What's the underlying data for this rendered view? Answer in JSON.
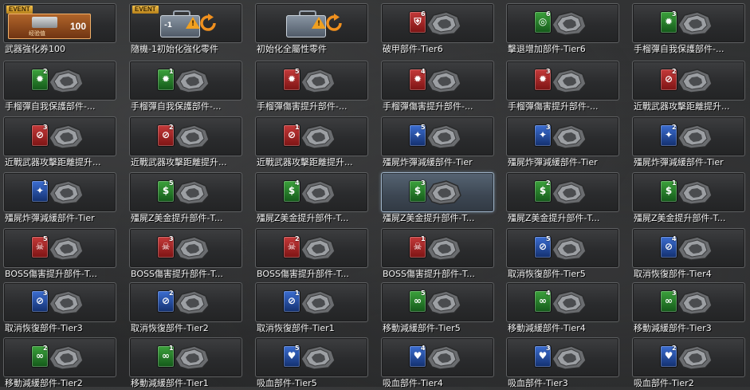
{
  "badge_text": "EVENT",
  "coupon": {
    "count": "100",
    "caption": "经验值"
  },
  "toolbox_text": "-1",
  "selected_index": 21,
  "chip_colors": {
    "red": "#c53a3a",
    "green": "#3ca23c",
    "blue": "#3c6ed2"
  },
  "items": [
    {
      "label": "武器強化券100",
      "kind": "coupon",
      "event": true
    },
    {
      "label": "隨機-1初始化強化零件",
      "kind": "toolbox",
      "event": true,
      "toolbox_text": "-1"
    },
    {
      "label": "初始化全屬性零件",
      "kind": "toolbox",
      "event": false
    },
    {
      "label": "破甲部件-Tier6",
      "kind": "part",
      "color": "red",
      "icon": "shield-icon",
      "tier": "6"
    },
    {
      "label": "擊退增加部件-Tier6",
      "kind": "part",
      "color": "green",
      "icon": "knockback-icon",
      "tier": "6"
    },
    {
      "label": "手榴彈自我保護部件-...",
      "kind": "part",
      "color": "green",
      "icon": "grenade-icon",
      "tier": "3"
    },
    {
      "label": "手榴彈自我保護部件-...",
      "kind": "part",
      "color": "green",
      "icon": "grenade-icon",
      "tier": "2"
    },
    {
      "label": "手榴彈自我保護部件-...",
      "kind": "part",
      "color": "green",
      "icon": "grenade-icon",
      "tier": "1"
    },
    {
      "label": "手榴彈傷害提升部件-...",
      "kind": "part",
      "color": "red",
      "icon": "grenade-icon",
      "tier": "5"
    },
    {
      "label": "手榴彈傷害提升部件-...",
      "kind": "part",
      "color": "red",
      "icon": "grenade-icon",
      "tier": "4"
    },
    {
      "label": "手榴彈傷害提升部件-...",
      "kind": "part",
      "color": "red",
      "icon": "grenade-icon",
      "tier": "3"
    },
    {
      "label": "近戰武器攻擊距離提升...",
      "kind": "part",
      "color": "red",
      "icon": "no-melee-icon",
      "tier": "2"
    },
    {
      "label": "近戰武器攻擊距離提升...",
      "kind": "part",
      "color": "red",
      "icon": "no-melee-icon",
      "tier": "3"
    },
    {
      "label": "近戰武器攻擊距離提升...",
      "kind": "part",
      "color": "red",
      "icon": "no-melee-icon",
      "tier": "2"
    },
    {
      "label": "近戰武器攻擊距離提升...",
      "kind": "part",
      "color": "red",
      "icon": "no-melee-icon",
      "tier": "1"
    },
    {
      "label": "殭屍炸彈減緩部件-Tier",
      "kind": "part",
      "color": "blue",
      "icon": "bomb-slow-icon",
      "tier": "5"
    },
    {
      "label": "殭屍炸彈減緩部件-Tier",
      "kind": "part",
      "color": "blue",
      "icon": "bomb-slow-icon",
      "tier": "3"
    },
    {
      "label": "殭屍炸彈減緩部件-Tier",
      "kind": "part",
      "color": "blue",
      "icon": "bomb-slow-icon",
      "tier": "2"
    },
    {
      "label": "殭屍炸彈減緩部件-Tier",
      "kind": "part",
      "color": "blue",
      "icon": "bomb-slow-icon",
      "tier": "1"
    },
    {
      "label": "殭屍Z美金提升部件-T...",
      "kind": "part",
      "color": "green",
      "icon": "dollar-icon",
      "tier": "5"
    },
    {
      "label": "殭屍Z美金提升部件-T...",
      "kind": "part",
      "color": "green",
      "icon": "dollar-icon",
      "tier": "4"
    },
    {
      "label": "殭屍Z美金提升部件-T...",
      "kind": "part",
      "color": "green",
      "icon": "dollar-icon",
      "tier": "3"
    },
    {
      "label": "殭屍Z美金提升部件-T...",
      "kind": "part",
      "color": "green",
      "icon": "dollar-icon",
      "tier": "2"
    },
    {
      "label": "殭屍Z美金提升部件-T...",
      "kind": "part",
      "color": "green",
      "icon": "dollar-icon",
      "tier": "1"
    },
    {
      "label": "BOSS傷害提升部件-T...",
      "kind": "part",
      "color": "red",
      "icon": "boss-icon",
      "tier": "5"
    },
    {
      "label": "BOSS傷害提升部件-T...",
      "kind": "part",
      "color": "red",
      "icon": "boss-icon",
      "tier": "3"
    },
    {
      "label": "BOSS傷害提升部件-T...",
      "kind": "part",
      "color": "red",
      "icon": "boss-icon",
      "tier": "2"
    },
    {
      "label": "BOSS傷害提升部件-T...",
      "kind": "part",
      "color": "red",
      "icon": "boss-icon",
      "tier": "1"
    },
    {
      "label": "取消恢復部件-Tier5",
      "kind": "part",
      "color": "blue",
      "icon": "no-heal-icon",
      "tier": "5"
    },
    {
      "label": "取消恢復部件-Tier4",
      "kind": "part",
      "color": "blue",
      "icon": "no-heal-icon",
      "tier": "4"
    },
    {
      "label": "取消恢復部件-Tier3",
      "kind": "part",
      "color": "blue",
      "icon": "no-heal-icon",
      "tier": "3"
    },
    {
      "label": "取消恢復部件-Tier2",
      "kind": "part",
      "color": "blue",
      "icon": "no-heal-icon",
      "tier": "2"
    },
    {
      "label": "取消恢復部件-Tier1",
      "kind": "part",
      "color": "blue",
      "icon": "no-heal-icon",
      "tier": "1"
    },
    {
      "label": "移動減緩部件-Tier5",
      "kind": "part",
      "color": "green",
      "icon": "chain-icon",
      "tier": "5"
    },
    {
      "label": "移動減緩部件-Tier4",
      "kind": "part",
      "color": "green",
      "icon": "chain-icon",
      "tier": "4"
    },
    {
      "label": "移動減緩部件-Tier3",
      "kind": "part",
      "color": "green",
      "icon": "chain-icon",
      "tier": "3"
    },
    {
      "label": "移動減緩部件-Tier2",
      "kind": "part",
      "color": "green",
      "icon": "chain-icon",
      "tier": "2"
    },
    {
      "label": "移動減緩部件-Tier1",
      "kind": "part",
      "color": "green",
      "icon": "chain-icon",
      "tier": "1"
    },
    {
      "label": "吸血部件-Tier5",
      "kind": "part",
      "color": "blue",
      "icon": "lifesteal-icon",
      "tier": "5"
    },
    {
      "label": "吸血部件-Tier4",
      "kind": "part",
      "color": "blue",
      "icon": "lifesteal-icon",
      "tier": "4"
    },
    {
      "label": "吸血部件-Tier3",
      "kind": "part",
      "color": "blue",
      "icon": "lifesteal-icon",
      "tier": "3"
    },
    {
      "label": "吸血部件-Tier2",
      "kind": "part",
      "color": "blue",
      "icon": "lifesteal-icon",
      "tier": "2"
    }
  ]
}
